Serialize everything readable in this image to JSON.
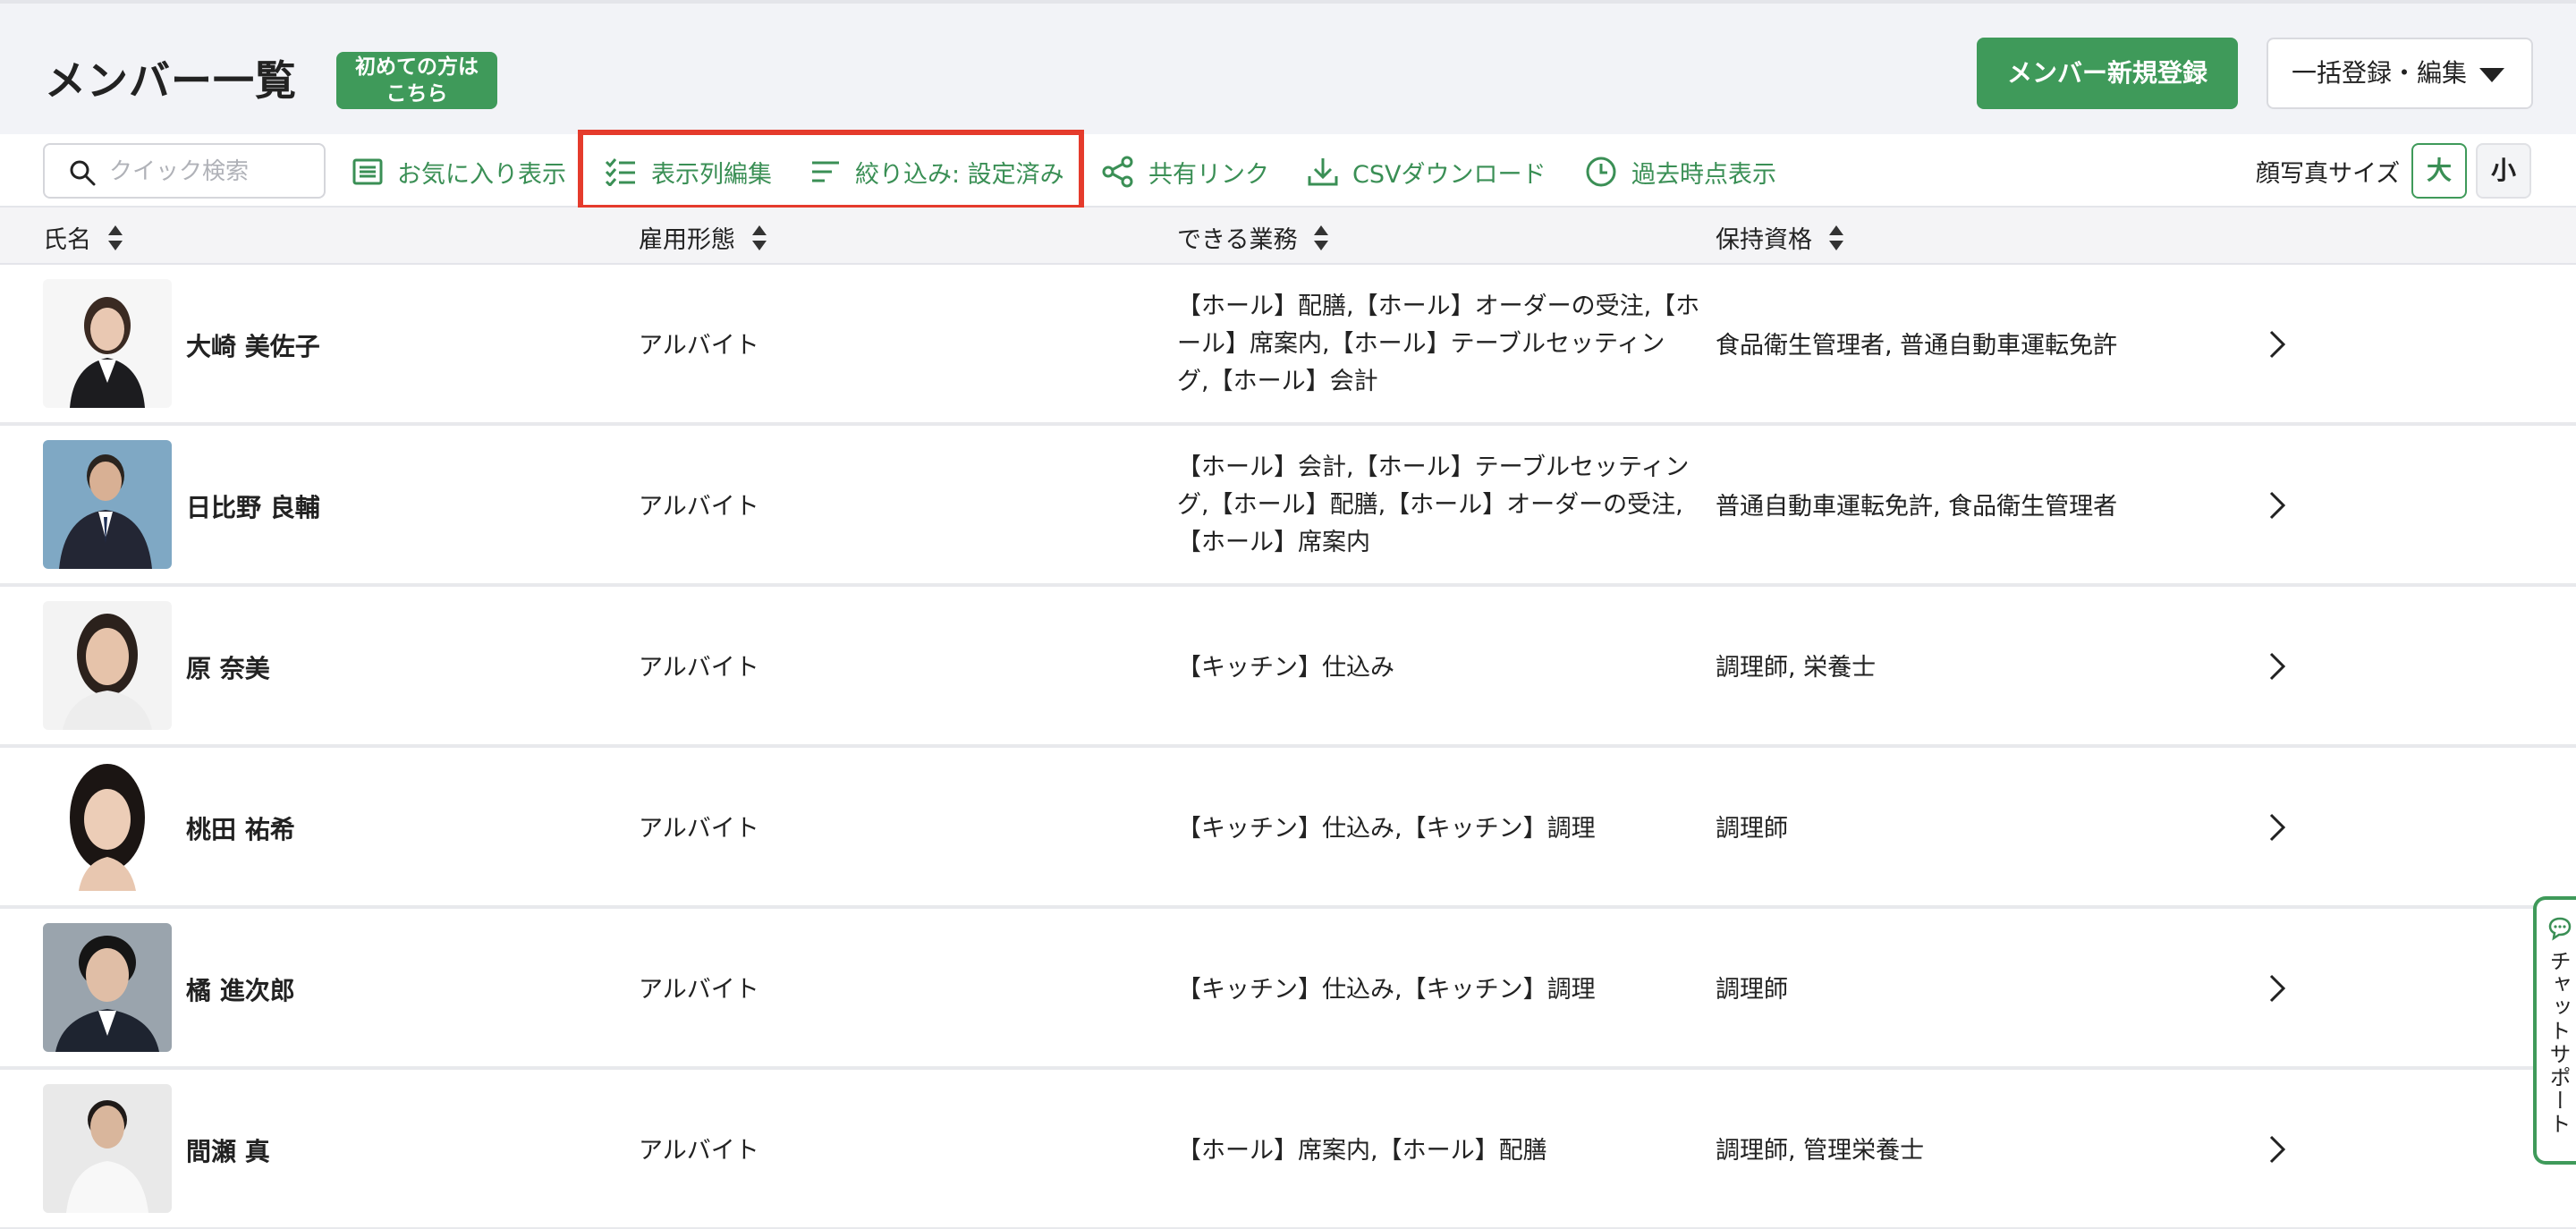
{
  "header": {
    "title": "メンバー一覧",
    "beginner_badge_line1": "初めての方は",
    "beginner_badge_line2": "こちら",
    "new_member_button": "メンバー新規登録",
    "bulk_button": "一括登録・編集"
  },
  "toolbar": {
    "search_placeholder": "クイック検索",
    "favorites": "お気に入り表示",
    "edit_columns": "表示列編集",
    "filter": "絞り込み: 設定済み",
    "share_link": "共有リンク",
    "csv_download": "CSVダウンロード",
    "past_view": "過去時点表示",
    "photo_size_label": "顔写真サイズ",
    "size_large": "大",
    "size_small": "小"
  },
  "table": {
    "columns": [
      "氏名",
      "雇用形態",
      "できる業務",
      "保持資格"
    ],
    "rows": [
      {
        "name": "大崎 美佐子",
        "employment": "アルバイト",
        "tasks": [
          "【ホール】配膳,【ホール】オーダーの受注,【ホ",
          "ール】席案内,【ホール】テーブルセッティン",
          "グ,【ホール】会計"
        ],
        "qualifications": "食品衛生管理者, 普通自動車運転免許"
      },
      {
        "name": "日比野 良輔",
        "employment": "アルバイト",
        "tasks": [
          "【ホール】会計,【ホール】テーブルセッティン",
          "グ,【ホール】配膳,【ホール】オーダーの受注,",
          "【ホール】席案内"
        ],
        "qualifications": "普通自動車運転免許, 食品衛生管理者"
      },
      {
        "name": "原 奈美",
        "employment": "アルバイト",
        "tasks": [
          "【キッチン】仕込み"
        ],
        "qualifications": "調理師, 栄養士"
      },
      {
        "name": "桃田 祐希",
        "employment": "アルバイト",
        "tasks": [
          "【キッチン】仕込み,【キッチン】調理"
        ],
        "qualifications": "調理師"
      },
      {
        "name": "橘 進次郎",
        "employment": "アルバイト",
        "tasks": [
          "【キッチン】仕込み,【キッチン】調理"
        ],
        "qualifications": "調理師"
      },
      {
        "name": "間瀬 真",
        "employment": "アルバイト",
        "tasks": [
          "【ホール】席案内,【ホール】配膳"
        ],
        "qualifications": "調理師, 管理栄養士"
      }
    ]
  },
  "chat_support": "チャットサポート",
  "colors": {
    "brand_green": "#3f9a5a",
    "link_green": "#3a8f55",
    "highlight_red": "#e53b2c",
    "header_bg": "#f2f3f7"
  },
  "icons": [
    "search-icon",
    "list-icon",
    "checklist-icon",
    "filter-icon",
    "share-icon",
    "download-icon",
    "clock-icon",
    "sort-icon",
    "chevron-right-icon",
    "chat-icon",
    "caret-down-icon"
  ]
}
